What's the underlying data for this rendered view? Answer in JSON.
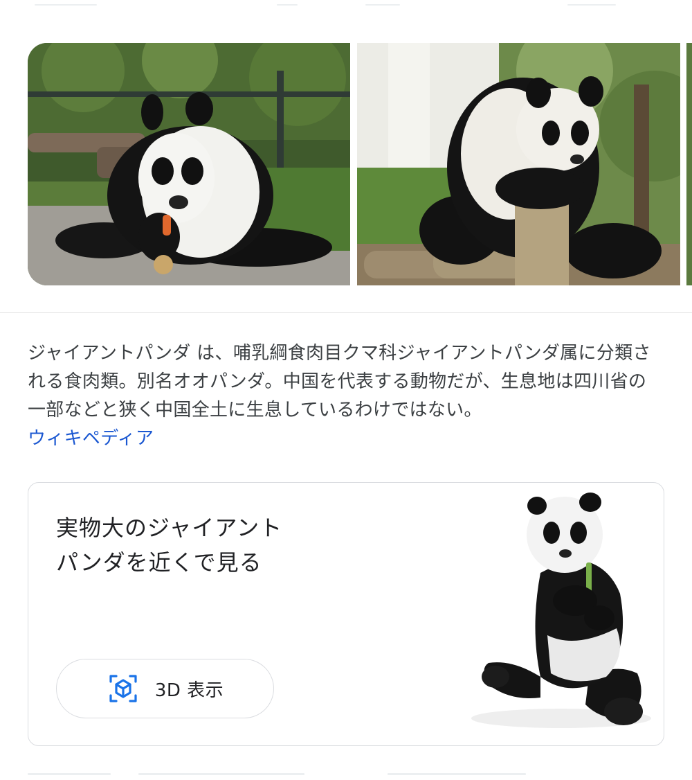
{
  "description": {
    "text": "ジャイアントパンダ は、哺乳綱食肉目クマ科ジャイアントパンダ属に分類される食肉類。別名オオパンダ。中国を代表する動物だが、生息地は四川省の一部などと狭く中国全土に生息しているわけではない。",
    "source_link": "ウィキペディア"
  },
  "card": {
    "title": "実物大のジャイアントパンダを近くで見る",
    "button_label": "3D 表示",
    "button_icon": "3d-cube-icon"
  },
  "colors": {
    "link": "#1a57d1",
    "icon_blue": "#1a73e8",
    "border": "#dadce0"
  }
}
